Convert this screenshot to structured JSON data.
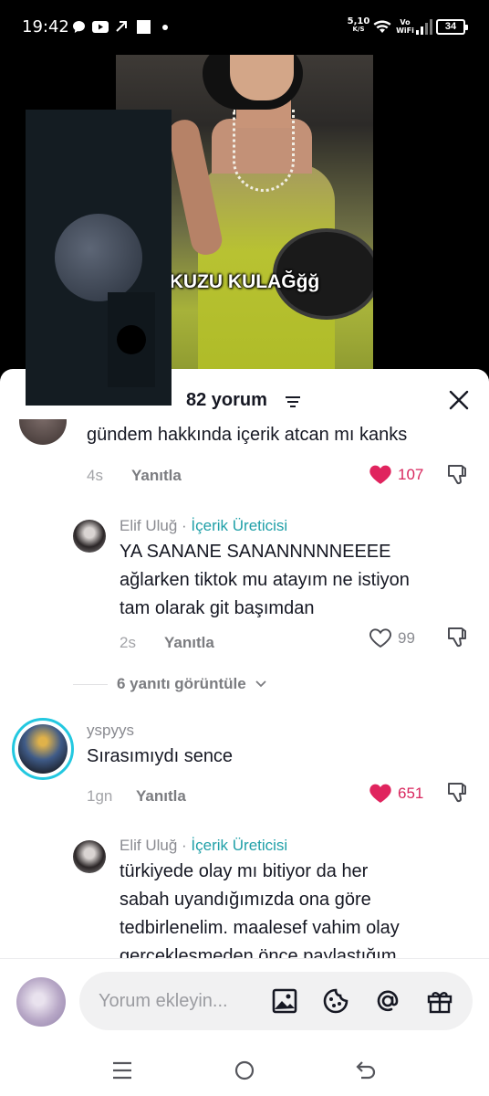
{
  "status_bar": {
    "time": "19:42",
    "net_speed": "5,10",
    "net_unit": "K/S",
    "vowifi": "Vo\nWiFi",
    "battery": "34",
    "icons": [
      "chat-bubble-icon",
      "youtube-icon",
      "arrow-icon",
      "square-icon",
      "dot-icon",
      "wifi-icon",
      "signal-icon",
      "battery-icon"
    ]
  },
  "video": {
    "caption": "KUZU KULAĞğğ"
  },
  "sheet": {
    "title": "82 yorum",
    "close_icon": "close-icon",
    "sort_icon": "sort-icon"
  },
  "comments": [
    {
      "text": "gündem hakkında içerik atcan mı kanks",
      "time": "4s",
      "reply_label": "Yanıtla",
      "likes": "107",
      "liked": true
    },
    {
      "username": "Elif Uluğ",
      "separator": " · ",
      "badge": "İçerik Üreticisi",
      "text_lines": [
        "YA SANANE SANANNNNNEEEE",
        "ağlarken tiktok mu atayım ne istiyon",
        "tam olarak git başımdan"
      ],
      "time": "2s",
      "reply_label": "Yanıtla",
      "likes": "99",
      "liked": false
    },
    {
      "username": "yspyys",
      "text": "Sırasımıydı sence",
      "time": "1gn",
      "reply_label": "Yanıtla",
      "likes": "651",
      "liked": true
    },
    {
      "username": "Elif Uluğ",
      "separator": " · ",
      "badge": "İçerik Üreticisi",
      "text_lines": [
        "türkiyede olay mı bitiyor da her",
        "sabah uyandığımızda ona göre",
        "tedbirlenelim. maalesef vahim olay",
        "gerçekleşmeden önce paylaştığım"
      ]
    }
  ],
  "view_replies": "6 yanıtı görüntüle",
  "input": {
    "placeholder": "Yorum ekleyin...",
    "icons": [
      "image-icon",
      "emoji-icon",
      "mention-icon",
      "gift-icon"
    ]
  },
  "colors": {
    "accent_red": "#d8265d",
    "creator_teal": "#20a0a8"
  }
}
